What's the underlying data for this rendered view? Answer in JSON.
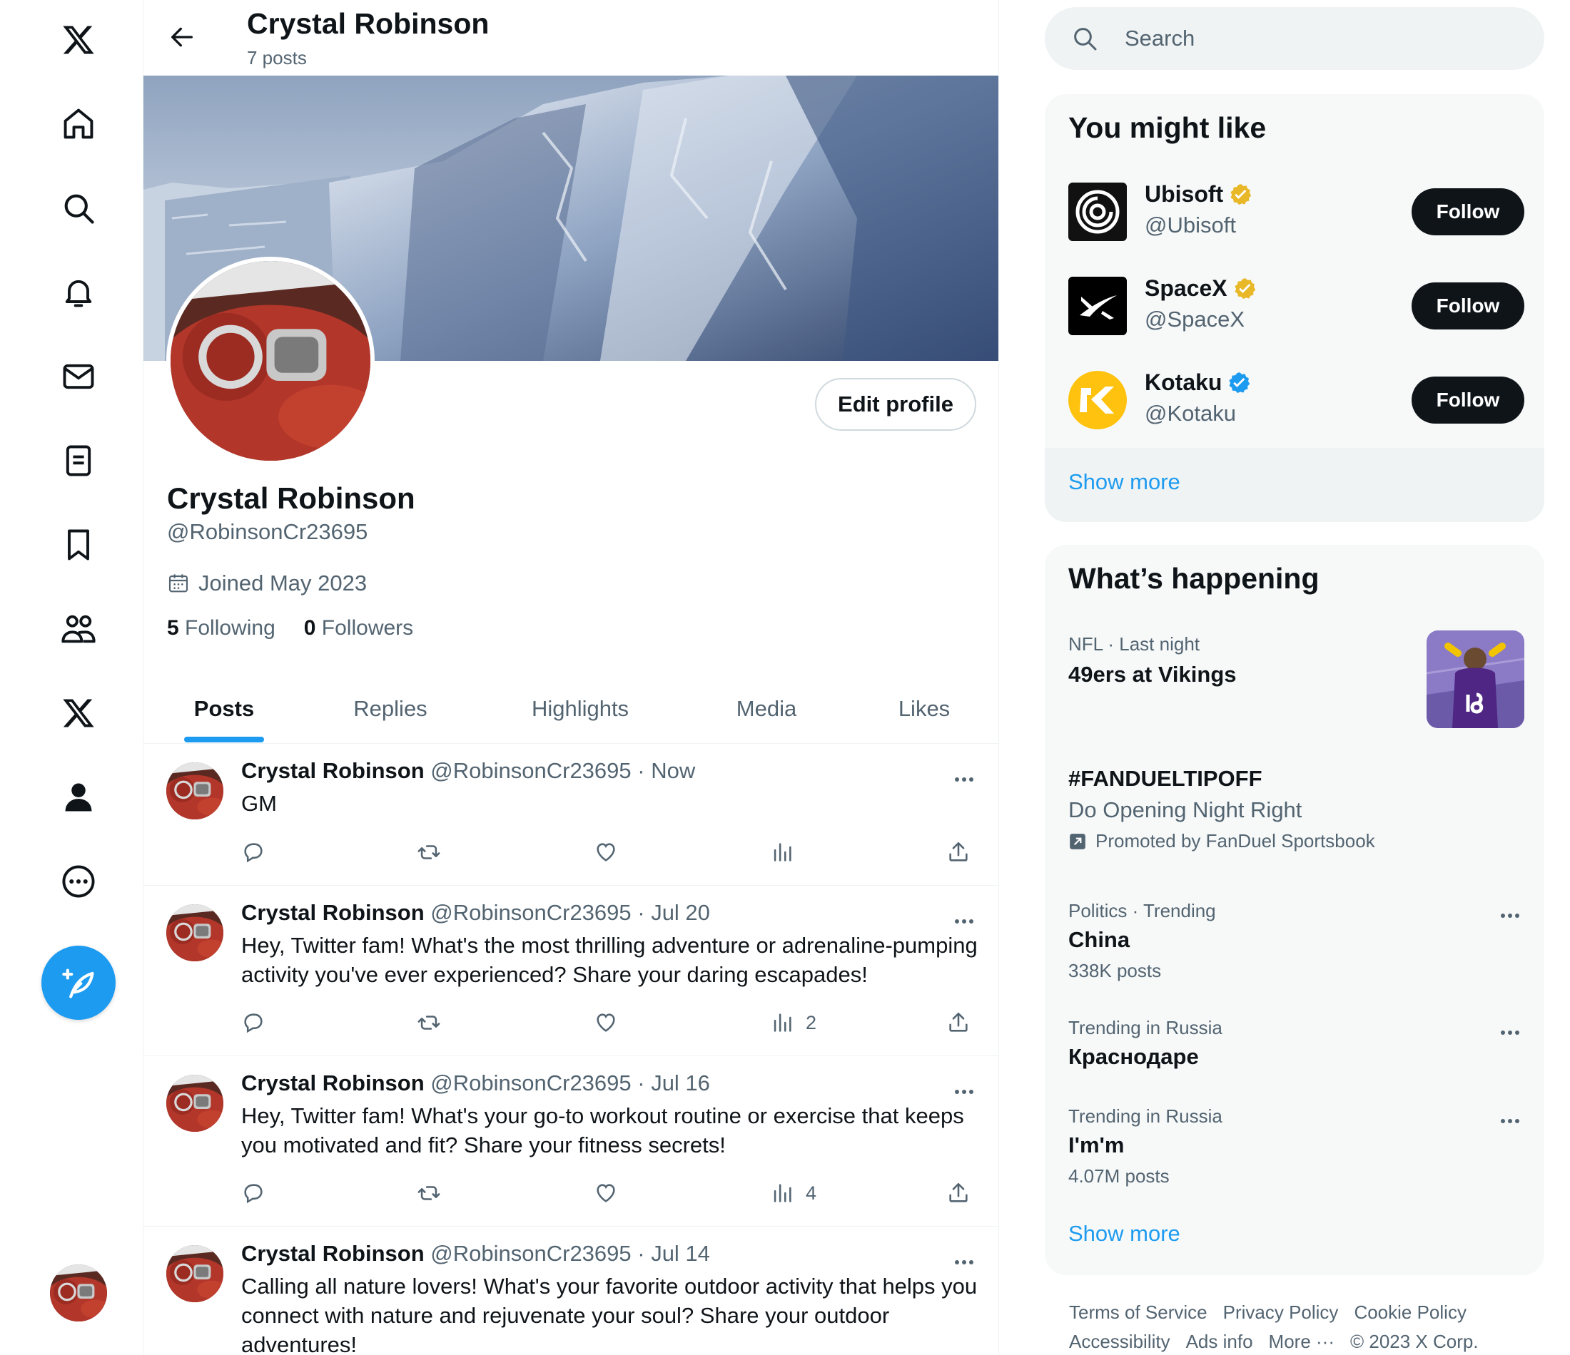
{
  "profile": {
    "name": "Crystal Robinson",
    "post_count": "7 posts",
    "handle": "@RobinsonCr23695",
    "joined": "Joined May 2023",
    "following_count": "5",
    "following_label": "Following",
    "followers_count": "0",
    "followers_label": "Followers",
    "edit_profile_label": "Edit profile"
  },
  "tabs": [
    {
      "label": "Posts",
      "active": true
    },
    {
      "label": "Replies",
      "active": false
    },
    {
      "label": "Highlights",
      "active": false
    },
    {
      "label": "Media",
      "active": false
    },
    {
      "label": "Likes",
      "active": false
    }
  ],
  "posts": [
    {
      "name": "Crystal Robinson",
      "meta": "@RobinsonCr23695 · Now",
      "text": "GM",
      "views": ""
    },
    {
      "name": "Crystal Robinson",
      "meta": "@RobinsonCr23695 · Jul 20",
      "text": "Hey, Twitter fam! What's the most thrilling adventure or adrenaline-pumping activity you've ever experienced? Share your daring escapades!",
      "views": "2"
    },
    {
      "name": "Crystal Robinson",
      "meta": "@RobinsonCr23695 · Jul 16",
      "text": "Hey, Twitter fam! What's your go-to workout routine or exercise that keeps you motivated and fit? Share your fitness secrets!",
      "views": "4"
    },
    {
      "name": "Crystal Robinson",
      "meta": "@RobinsonCr23695 · Jul 14",
      "text": "Calling all nature lovers! What's your favorite outdoor activity that helps you connect with nature and rejuvenate your soul? Share your outdoor adventures!",
      "views": ""
    }
  ],
  "search": {
    "placeholder": "Search"
  },
  "you_might_like": {
    "title": "You might like",
    "items": [
      {
        "name": "Ubisoft",
        "handle": "@Ubisoft",
        "badge": "gold",
        "follow_label": "Follow"
      },
      {
        "name": "SpaceX",
        "handle": "@SpaceX",
        "badge": "gold",
        "follow_label": "Follow"
      },
      {
        "name": "Kotaku",
        "handle": "@Kotaku",
        "badge": "blue",
        "follow_label": "Follow"
      }
    ],
    "show_more": "Show more"
  },
  "whats_happening": {
    "title": "What’s happening",
    "trends": [
      {
        "meta": "NFL · Last night",
        "title": "49ers at Vikings"
      },
      {
        "title": "#FANDUELTIPOFF",
        "subtitle": "Do Opening Night Right",
        "promoted": "Promoted by FanDuel Sportsbook"
      },
      {
        "meta": "Politics · Trending",
        "title": "China",
        "count": "338K posts"
      },
      {
        "meta": "Trending in Russia",
        "title": "Краснодаре"
      },
      {
        "meta": "Trending in Russia",
        "title": "I'm'm",
        "count": "4.07M posts"
      }
    ],
    "show_more": "Show more"
  },
  "footer": {
    "links": [
      "Terms of Service",
      "Privacy Policy",
      "Cookie Policy",
      "Accessibility",
      "Ads info",
      "More ···",
      "© 2023 X Corp."
    ]
  },
  "colors": {
    "accent": "#1d9bf0",
    "text": "#0f1419",
    "secondary": "#536471",
    "gold": "#e8b829"
  },
  "icons": [
    "x-logo-icon",
    "home-icon",
    "search-icon",
    "bell-icon",
    "mail-icon",
    "lists-icon",
    "bookmark-icon",
    "communities-icon",
    "premium-x-icon",
    "profile-icon",
    "more-circle-icon",
    "compose-icon"
  ]
}
